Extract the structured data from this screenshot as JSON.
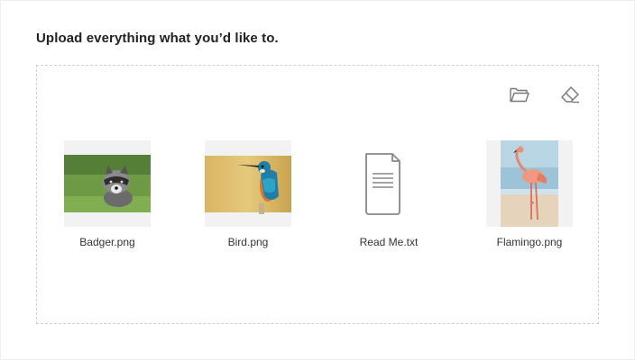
{
  "title": "Upload everything what you’d like to.",
  "toolbar": {
    "open_icon": "folder-open-icon",
    "clear_icon": "eraser-icon"
  },
  "files": [
    {
      "name": "Badger.png",
      "kind": "image"
    },
    {
      "name": "Bird.png",
      "kind": "image"
    },
    {
      "name": "Read Me.txt",
      "kind": "document"
    },
    {
      "name": "Flamingo.png",
      "kind": "image"
    }
  ],
  "colors": {
    "text": "#222222",
    "border": "#cfcfcf",
    "icon": "#777777",
    "thumb_bg": "#f2f2f2"
  }
}
